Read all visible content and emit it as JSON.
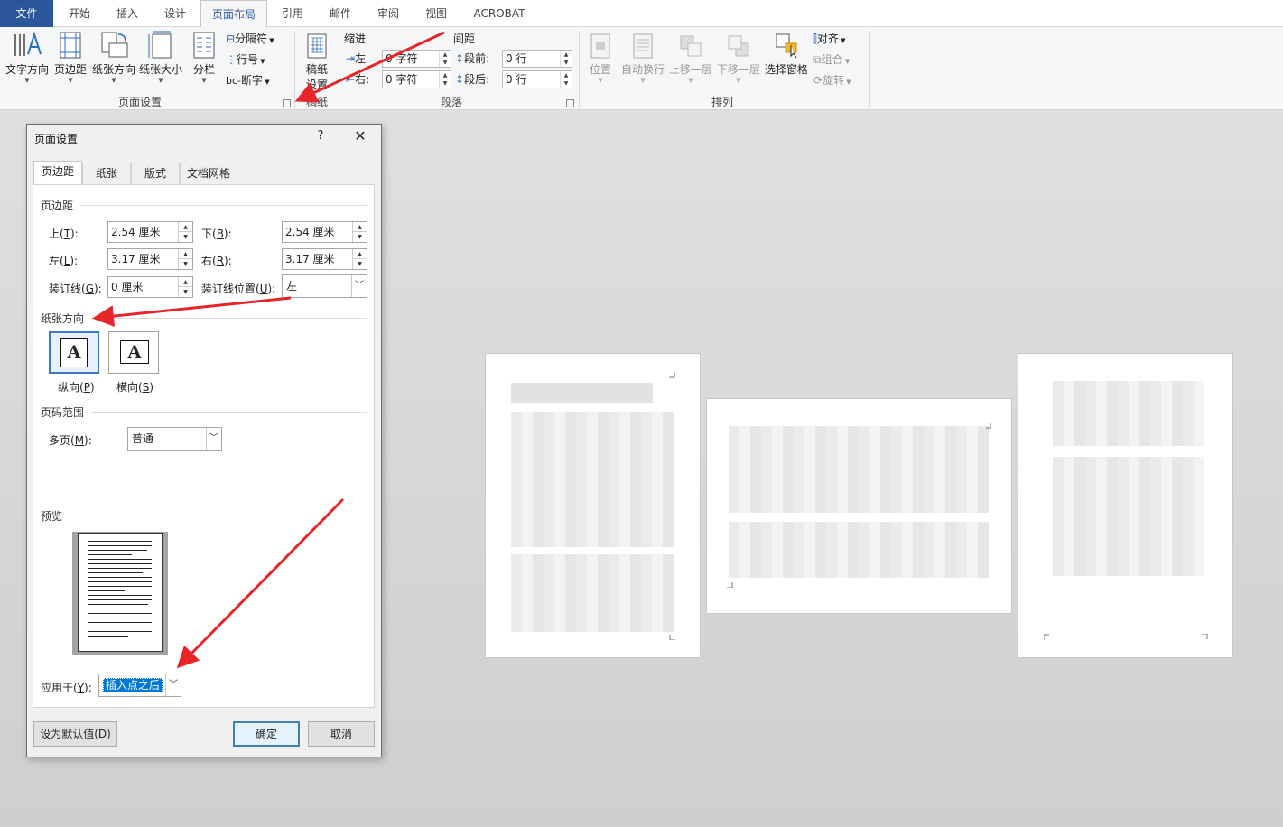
{
  "tabs": [
    {
      "label": "文件"
    },
    {
      "label": "开始"
    },
    {
      "label": "插入"
    },
    {
      "label": "设计"
    },
    {
      "label": "页面布局"
    },
    {
      "label": "引用"
    },
    {
      "label": "邮件"
    },
    {
      "label": "审阅"
    },
    {
      "label": "视图"
    },
    {
      "label": "ACROBAT"
    }
  ],
  "ribbon": {
    "page_setup": {
      "text_direction": "文字方向",
      "margins": "页边距",
      "orientation": "纸张方向",
      "size": "纸张大小",
      "columns": "分栏",
      "breaks": "分隔符",
      "line_numbers": "行号",
      "hyphenation": "断字",
      "group_label": "页面设置"
    },
    "manuscript": {
      "button_line1": "稿纸",
      "button_line2": "设置",
      "group_label": "稿纸"
    },
    "paragraph": {
      "indent_title": "缩进",
      "spacing_title": "间距",
      "left_label": "左",
      "right_label": "右:",
      "left_value": "0 字符",
      "right_value": "0 字符",
      "before_label": "段前:",
      "after_label": "段后:",
      "before_value": "0 行",
      "after_value": "0 行",
      "group_label": "段落"
    },
    "arrange": {
      "position": "位置",
      "wrap_text": "自动换行",
      "bring_forward": "上移一层",
      "send_backward": "下移一层",
      "selection_pane": "选择窗格",
      "align": "对齐",
      "group": "组合",
      "rotate": "旋转",
      "group_label": "排列"
    }
  },
  "dialog": {
    "title": "页面设置",
    "help": "?",
    "close": "✕",
    "tabs": [
      "页边距",
      "纸张",
      "版式",
      "文档网格"
    ],
    "margins_section": "页边距",
    "top_label": "上(",
    "top_key": "T",
    "top_value": "2.54 厘米",
    "bottom_label": "下(",
    "bottom_key": "B",
    "bottom_value": "2.54 厘米",
    "left_label": "左(",
    "left_key": "L",
    "left_value": "3.17 厘米",
    "right_label": "右(",
    "right_key": "R",
    "right_value": "3.17 厘米",
    "gutter_label": "装订线(",
    "gutter_key": "G",
    "gutter_value": "0 厘米",
    "gutter_pos_label": "装订线位置(",
    "gutter_pos_key": "U",
    "gutter_pos_value": "左",
    "orientation_section": "纸张方向",
    "portrait_label": "纵向(",
    "portrait_key": "P",
    "landscape_label": "横向(",
    "landscape_key": "S",
    "orientation_glyph": "A",
    "pages_section": "页码范围",
    "multiple_pages_label": "多页(",
    "multiple_pages_key": "M",
    "multiple_pages_value": "普通",
    "preview_section": "预览",
    "apply_to_label": "应用于(",
    "apply_to_key": "Y",
    "apply_to_value": "插入点之后",
    "set_default": "设为默认值(",
    "set_default_key": "D",
    "ok": "确定",
    "cancel": "取消"
  },
  "colors": {
    "file_tab": "#2b579a",
    "selection": "#0078d7",
    "arrow": "#e8262a"
  }
}
